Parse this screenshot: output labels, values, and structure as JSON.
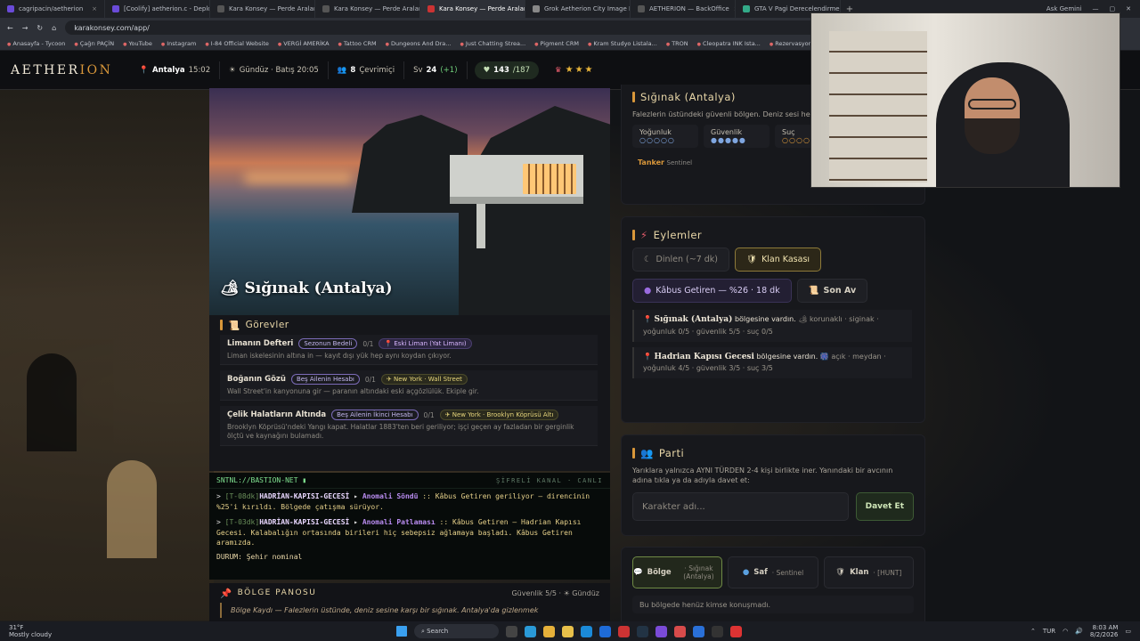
{
  "browser": {
    "tabs": [
      {
        "label": "cagripacin/aetherion"
      },
      {
        "label": "[Coolify] aetherion.c - Deploy"
      },
      {
        "label": "Kara Konsey — Perde Aralanıyo"
      },
      {
        "label": "Kara Konsey — Perde Aralanıyo"
      },
      {
        "label": "Kara Konsey — Perde Aralanıyo"
      },
      {
        "label": "Grok Aetherion City Image Pro"
      },
      {
        "label": "AETHERION — BackOffice"
      },
      {
        "label": "GTA V Pagi Derecelendirmesi"
      }
    ],
    "profile": "Ask Gemini",
    "url": "karakonsey.com/app/",
    "bookmarks": [
      "Anasayfa - Tycoon",
      "Çağrı PAÇİN",
      "YouTube",
      "Instagram",
      "I-84 Official Website",
      "VERGİ AMERİKA",
      "Tattoo CRM",
      "Dungeons And Dra...",
      "Just Chatting Strea...",
      "Pigment CRM",
      "Kram Studyo Listala...",
      "TRON",
      "Cleopatra INK Ista...",
      "Rezervasyonlar | Cl..."
    ]
  },
  "header": {
    "logo_a": "AETHER",
    "logo_b": "ION",
    "location": "Antalya",
    "location_time": "15:02",
    "daytime": "Gündüz · Batış 20:05",
    "online_count": "8",
    "online_label": "Çevrimiçi",
    "level_prefix": "Sv",
    "level": "24",
    "level_gain": "(+1)",
    "hp": "143",
    "hp_max": "/187",
    "stars": "★★★"
  },
  "hero": {
    "title": "🏕 Sığınak (Antalya)"
  },
  "tasks": {
    "heading": "Görevler",
    "items": [
      {
        "name": "Limanın Defteri",
        "tag": "Sezonun Bedeli",
        "count": "0/1",
        "location": "📍 Eski Liman (Yat Limanı)",
        "desc": "Liman iskelesinin altına in — kayıt dışı yük hep aynı koydan çıkıyor."
      },
      {
        "name": "Boğanın Gözü",
        "tag": "Beş Ailenin Hesabı",
        "count": "0/1",
        "location": "✈ New York · Wall Street",
        "desc": "Wall Street'in kanyonuna gir — paranın altındaki eski açgözlülük. Ekiple gir."
      },
      {
        "name": "Çelik Halatların Altında",
        "tag": "Beş Ailenin İkinci Hesabı",
        "count": "0/1",
        "location": "✈ New York · Brooklyn Köprüsü Altı",
        "desc": "Brooklyn Köprüsü'ndeki Yangı kapat. Halatlar 1883'ten beri geriliyor; işçi geçen ay fazladan bir gerginlik ölçtü ve kaynağını bulamadı."
      }
    ]
  },
  "terminal": {
    "title": "SNTNL://BASTION-NET ▮",
    "right": "ŞİFRELİ KANAL · CANLI",
    "lines": [
      {
        "prompt": ">",
        "tag": "[T-08dk]",
        "zone": "HADRİAN-KAPISI-GECESİ",
        "arrow": "▸",
        "event": "Anomali Söndü",
        "text": ":: Kâbus Getiren geriliyor — direncinin %25'i kırıldı. Bölgede çatışma sürüyor."
      },
      {
        "prompt": ">",
        "tag": "[T-03dk]",
        "zone": "HADRİAN-KAPISI-GECESİ",
        "arrow": "▸",
        "event": "Anomali Patlaması",
        "text": ":: Kâbus Getiren — Hadrian Kapısı Gecesi. Kalabalığın ortasında birileri hiç sebepsiz ağlamaya başladı. Kâbus Getiren aramızda."
      }
    ],
    "status": "DURUM: Şehir nominal"
  },
  "pano": {
    "heading": "BÖLGE PANOSU",
    "right": "Güvenlik 5/5 · ☀ Gündüz",
    "log": "Bölge Kaydı — Falezlerin üstünde, deniz sesine karşı bir sığınak. Antalya'da gizlenmek"
  },
  "zone": {
    "heading": "Sığınak (Antalya)",
    "desc": "Falezlerin üstündeki güvenli bölgen. Deniz sesi her şeyi.",
    "stats": [
      {
        "label": "Yoğunluk",
        "dots": "○○○○○"
      },
      {
        "label": "Güvenlik",
        "dots": "●●●●●"
      },
      {
        "label": "Suç",
        "dots": "○○○○○"
      }
    ],
    "role": "Tanker",
    "role_sub": "Sentinel"
  },
  "actions": {
    "heading": "Eylemler",
    "rest": "Dinlen (~7 dk)",
    "vault": "Klan Kasası",
    "boss": "Kâbus Getiren — %26 · 18 dk",
    "hunt": "Son Av",
    "events": [
      {
        "place": "Sığınak (Antalya)",
        "text": "bölgesine vardın.",
        "meta": "🏕 korunaklı · siginak ·",
        "meta2": "yoğunluk 0/5 · güvenlik 5/5 · suç 0/5"
      },
      {
        "place": "Hadrian Kapısı Gecesi",
        "text": "bölgesine vardın.",
        "meta": "🎆 açık · meydan ·",
        "meta2": "yoğunluk 4/5 · güvenlik 3/5 · suç 3/5"
      }
    ]
  },
  "party": {
    "heading": "Parti",
    "desc": "Yarıklara yalnızca AYNI TÜRDEN 2-4 kişi birlikte iner. Yanındaki bir avcının adına tıkla ya da adıyla davet et:",
    "placeholder": "Karakter adı...",
    "invite": "Davet Et"
  },
  "chat": {
    "tabs": [
      {
        "label": "Bölge",
        "sub": "· Sığınak (Antalya)"
      },
      {
        "label": "Saf",
        "sub": "· Sentinel"
      },
      {
        "label": "Klan",
        "sub": "· [HUNT]"
      }
    ],
    "empty": "Bu bölgede henüz kimse konuşmadı."
  },
  "taskbar": {
    "weather_temp": "31°F",
    "weather_text": "Mostly cloudy",
    "search": "Search",
    "lang": "TUR",
    "time": "8:03 AM",
    "date": "8/2/2026"
  }
}
